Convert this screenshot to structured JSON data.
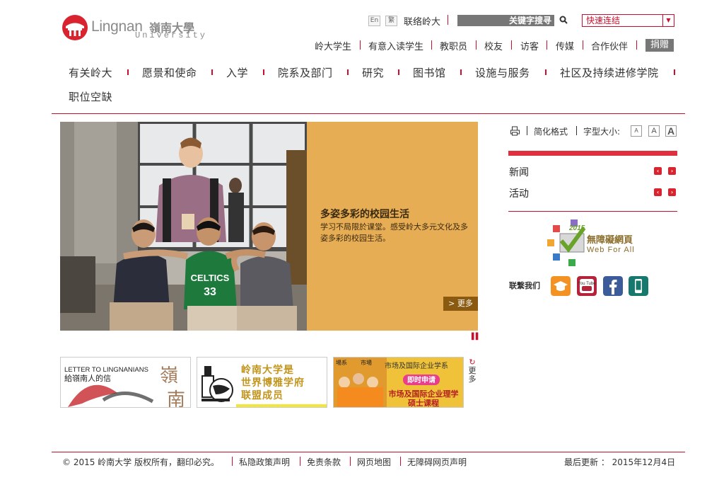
{
  "logo": {
    "name_en": "Lingnan",
    "name_cn": "嶺南大學",
    "subtitle": "University"
  },
  "utility": {
    "lang_en": "En",
    "lang_trad": "繁",
    "contact": "联络岭大",
    "search_label": "关键字搜寻",
    "quick_links": "快速连结",
    "donate": "捐赠"
  },
  "audience_links": [
    "岭大学生",
    "有意入读学生",
    "教职员",
    "校友",
    "访客",
    "传媒",
    "合作伙伴"
  ],
  "main_nav": [
    "有关岭大",
    "愿景和使命",
    "入学",
    "院系及部门",
    "研究",
    "图书馆",
    "设施与服务",
    "社区及持续进修学院",
    "职位空缺"
  ],
  "slide": {
    "title": "多姿多彩的校园生活",
    "description": "学习不局限於课堂。感受岭大多元文化及多姿多彩的校园生活。",
    "more": "> 更多",
    "jersey_text": "CELTICS",
    "jersey_number": "33"
  },
  "sidebar": {
    "simplified": "简化格式",
    "font_size": "字型大小:",
    "font_buttons": [
      "A",
      "A",
      "A"
    ],
    "links": [
      "新闻",
      "活动"
    ],
    "wfa_year": "2015",
    "wfa_cn": "無障礙網頁",
    "wfa_en": "Web For All",
    "follow_us": "联繫我们",
    "social_icons": [
      "education-icon",
      "youtube-icon",
      "facebook-icon",
      "mobile-app-icon"
    ],
    "social_youtube_text": "You Tube"
  },
  "banners": {
    "letter_line1": "LETTER TO LINGNANIANS",
    "letter_line2": "給嶺南人的信",
    "letter_calligraphy_1": "嶺",
    "letter_calligraphy_2": "南",
    "liberal_line1": "岭南大学是",
    "liberal_line2": "世界博雅学府",
    "liberal_line3": "联盟成员",
    "master_top": "市场及国际企业学系",
    "master_apply": "即时申请",
    "master_line1": "市场及国际企业理学",
    "master_line2": "硕士课程",
    "master_sign_1": "場系",
    "master_sign_2": "市場",
    "more": "更多"
  },
  "footer": {
    "copyright": "© 2015 岭南大学 版权所有，翻印必究。",
    "links": [
      "私隐政策声明",
      "免责条款",
      "网页地图",
      "无障碍网页声明"
    ],
    "last_updated": "最后更新 ： 2015年12月4日"
  },
  "colors": {
    "brand_red": "#c8102e",
    "slide_panel": "#e6ad55",
    "utility_grey": "#777777"
  }
}
